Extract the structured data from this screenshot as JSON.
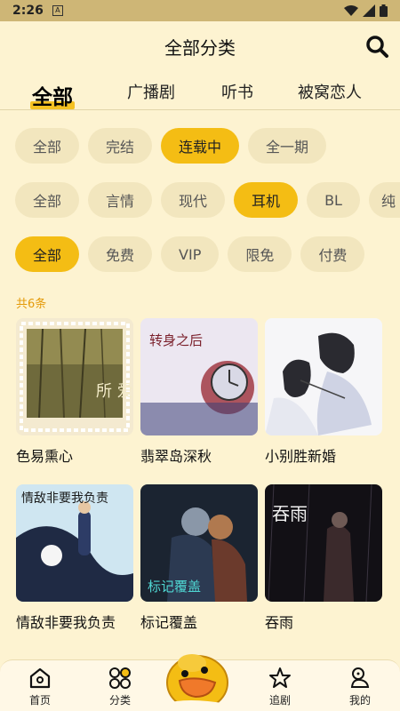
{
  "status_bar": {
    "time": "2:26",
    "notif_glyph": "A"
  },
  "header": {
    "title": "全部分类"
  },
  "top_tabs": [
    "全部",
    "广播剧",
    "听书",
    "被窝恋人"
  ],
  "filters": {
    "status": [
      "全部",
      "完结",
      "连载中",
      "全一期"
    ],
    "genre": [
      "全部",
      "言情",
      "现代",
      "耳机",
      "BL",
      "纯"
    ],
    "price": [
      "全部",
      "免费",
      "VIP",
      "限免",
      "付费"
    ]
  },
  "active": {
    "top_tab": "全部",
    "status": "连载中",
    "genre": "耳机",
    "price": "全部"
  },
  "result_count": "共6条",
  "works": [
    {
      "name": "色易熏心",
      "cover_text": "所 爱"
    },
    {
      "name": "翡翠岛深秋",
      "cover_text": "转身之后"
    },
    {
      "name": "小别胜新婚",
      "cover_text": ""
    },
    {
      "name": "情敌非要我负责",
      "cover_text": "情敌非要我负责"
    },
    {
      "name": "标记覆盖",
      "cover_text": "标记覆盖"
    },
    {
      "name": "吞雨",
      "cover_text": "吞雨"
    }
  ],
  "bottom_nav": [
    "首页",
    "分类",
    "追剧",
    "我的"
  ],
  "colors": {
    "background": "#fdf3d1",
    "accent": "#f4bd14",
    "chip": "#f2e6be",
    "count": "#e49a09"
  }
}
